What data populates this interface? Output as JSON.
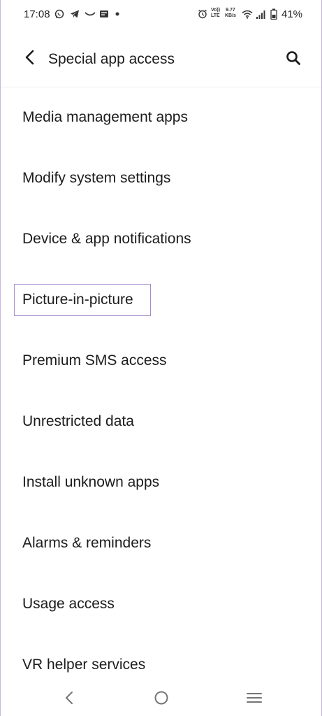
{
  "status_bar": {
    "time": "17:08",
    "volte_top": "Vo))",
    "volte_bottom": "LTE",
    "speed_value": "9.77",
    "speed_unit": "KB/s",
    "battery_percent": "41%",
    "icons": [
      "whatsapp-icon",
      "telegram-icon",
      "missed-call-icon",
      "message-icon",
      "dot-icon",
      "alarm-icon",
      "wifi-icon",
      "signal-icon",
      "battery-icon"
    ]
  },
  "header": {
    "title": "Special app access",
    "back_icon": "back-arrow-icon",
    "search_icon": "search-icon"
  },
  "list": {
    "items": [
      {
        "label": "Media management apps"
      },
      {
        "label": "Modify system settings"
      },
      {
        "label": "Device & app notifications"
      },
      {
        "label": "Picture-in-picture"
      },
      {
        "label": "Premium SMS access"
      },
      {
        "label": "Unrestricted data"
      },
      {
        "label": "Install unknown apps"
      },
      {
        "label": "Alarms & reminders"
      },
      {
        "label": "Usage access"
      },
      {
        "label": "VR helper services"
      }
    ]
  },
  "nav_bar": {
    "icons": [
      "nav-back-icon",
      "nav-home-icon",
      "nav-recents-icon"
    ]
  },
  "colors": {
    "text": "#1c1c1c",
    "highlight_border": "#a68fc9",
    "frame_border": "#c9b6dc",
    "nav_icon": "#757575"
  }
}
